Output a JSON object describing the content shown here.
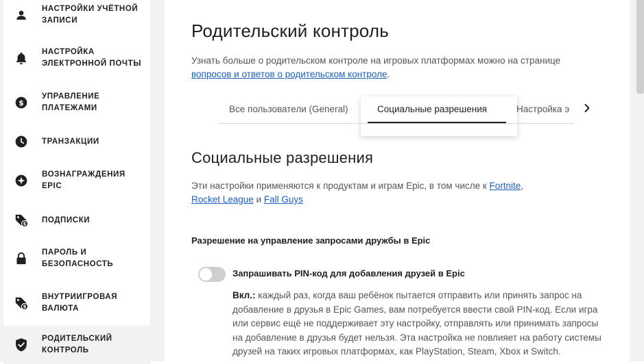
{
  "sidebar": {
    "items": [
      {
        "label": "Настройки учётной записи",
        "icon": "user-icon"
      },
      {
        "label": "Настройка электронной почты",
        "icon": "bell-icon"
      },
      {
        "label": "Управление платежами",
        "icon": "dollar-icon"
      },
      {
        "label": "Транзакции",
        "icon": "clock-icon"
      },
      {
        "label": "Вознаграждения Epic",
        "icon": "star-badge-icon"
      },
      {
        "label": "Подписки",
        "icon": "tag-dollar-icon"
      },
      {
        "label": "Пароль и безопасность",
        "icon": "lock-icon"
      },
      {
        "label": "Внутриигровая валюта",
        "icon": "tag-dollar-icon"
      },
      {
        "label": "Родительский контроль",
        "icon": "shield-check-icon",
        "active": true
      }
    ]
  },
  "page": {
    "title": "Родительский контроль",
    "intro_text": "Узнать больше о родительском контроле на игровых платформах можно на странице ",
    "intro_link": "вопросов и ответов о родительском контроле",
    "intro_end": "."
  },
  "tabs": [
    {
      "label": "Все пользователи (General)"
    },
    {
      "label": "Социальные разрешения",
      "active": true
    },
    {
      "label": "Настройка э"
    }
  ],
  "section": {
    "title": "Социальные разрешения",
    "desc_text": "Эти настройки применяются к продуктам и играм Epic, в том числе к ",
    "link_fortnite": "Fortnite",
    "comma": ",",
    "link_rocket": "Rocket League",
    "and": " и ",
    "link_fallguys": "Fall Guys"
  },
  "setting": {
    "heading": "Разрешение на управление запросами дружбы в Epic",
    "toggle_label": "Запрашивать PIN-код для добавления друзей в Epic",
    "toggle_on": false,
    "desc_prefix": "Вкл.:",
    "desc_body": " каждый раз, когда ваш ребёнок пытается отправить или принять запрос на добавление в друзья в Epic Games, вам потребуется ввести свой PIN-код. Если игра или сервис ещё не поддерживает эту настройку, отправлять или принимать запросы на добавление в друзья будет нельзя. Эта настройка не повлияет на работу системы друзей на таких игровых платформах, как PlayStation, Steam, Xbox и Switch."
  },
  "colors": {
    "accent_link": "#1a5fbf",
    "sidebar_bg": "#f2f2f2",
    "toggle_off": "#cfcfcf"
  }
}
